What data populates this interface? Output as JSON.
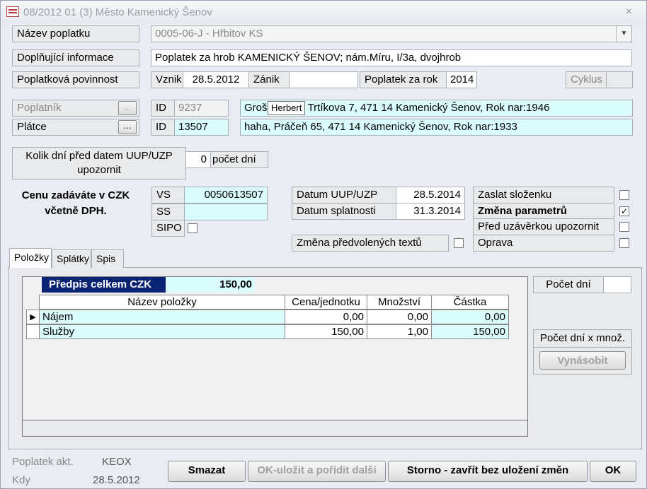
{
  "window": {
    "title": "08/2012   01  (3)  Město Kamenický Šenov",
    "close": "×"
  },
  "fields": {
    "nazev_label": "Název poplatku",
    "nazev_value": "0005-06-J - Hřbitov KS",
    "doplnujici_label": "Doplňující informace",
    "doplnujici_value": "Poplatek za hrob KAMENICKÝ ŠENOV;  nám.Míru, I/3a, dvojhrob",
    "povinnost_label": "Poplatková povinnost",
    "vznik_label": "Vznik",
    "vznik_value": "28.5.2012",
    "zanik_label": "Zánik",
    "zanik_value": "",
    "poplatek_rok_label": "Poplatek za rok",
    "poplatek_rok_value": "2014",
    "cyklus_label": "Cyklus",
    "poplatnik_label": "Poplatník",
    "poplatnik_id_label": "ID",
    "poplatnik_id": "9237",
    "poplatnik_text": "Groš",
    "poplatnik_text_rest": ", Trtíkova 7, 471 14 Kamenický Šenov, Rok nar:1946",
    "tooltip": "Herbert",
    "platce_label": "Plátce",
    "platce_id_label": "ID",
    "platce_id": "13507",
    "platce_text": "haha, Práčeň 65, 471 14 Kamenický Šenov, Rok nar:1933",
    "ellipsis": "...",
    "kolik_dni_label": "Kolik dní před datem UUP/UZP upozornit",
    "kolik_dni_value": "0",
    "pocet_dni_text": "počet dní",
    "cenu_text": "Cenu zadáváte v CZK včetně DPH.",
    "vs_label": "VS",
    "vs_value": "0050613507",
    "ss_label": "SS",
    "ss_value": "",
    "sipo_label": "SIPO",
    "datum_uup_label": "Datum UUP/UZP",
    "datum_uup_value": "28.5.2014",
    "datum_splat_label": "Datum splatnosti",
    "datum_splat_value": "31.3.2014",
    "zmena_textu_label": "Změna předvolených textů",
    "zaslat_label": "Zaslat složenku",
    "zmena_param_label": "Změna parametrů",
    "pred_uzav_label": "Před uzávěrkou upozornit",
    "oprava_label": "Oprava"
  },
  "checks": {
    "zaslat": "",
    "zmena_param": "✓",
    "pred_uzav": "",
    "oprava": "",
    "sipo": "",
    "zmena_textu": ""
  },
  "tabs": [
    "Položky",
    "Splátky",
    "Spis"
  ],
  "predpis": {
    "label": "Předpis celkem CZK",
    "value": "150,00"
  },
  "table": {
    "columns": [
      "Název položky",
      "Cena/jednotku",
      "Množství",
      "Částka"
    ],
    "rows": [
      {
        "name": "Nájem",
        "cena": "0,00",
        "mnozstvi": "0,00",
        "castka": "0,00"
      },
      {
        "name": "Služby",
        "cena": "150,00",
        "mnozstvi": "1,00",
        "castka": "150,00"
      }
    ]
  },
  "side": {
    "pocet_dni_label": "Počet dní",
    "pocet_dni_value": "",
    "pocet_x_label": "Počet dní x množ.",
    "vynasobit": "Vynásobit"
  },
  "footer": {
    "poplatek_akt_label": "Poplatek akt.",
    "poplatek_akt_value": "KEOX",
    "kdy_label": "Kdy",
    "kdy_value": "28.5.2012",
    "smazat": "Smazat",
    "ok_ulozit": "OK-uložit a pořídit další",
    "storno": "Storno - zavřít  bez uložení změn",
    "ok": "OK"
  }
}
